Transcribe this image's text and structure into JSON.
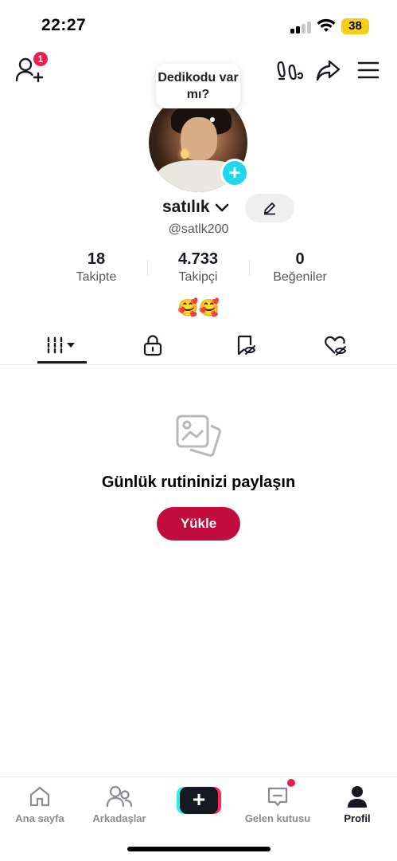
{
  "status_bar": {
    "time": "22:27",
    "battery": "38"
  },
  "top_bar": {
    "notification_count": "1",
    "icons": [
      "add-friend-icon",
      "footprints-icon",
      "share-icon",
      "menu-icon"
    ]
  },
  "profile": {
    "bubble_text": "Dedikodu var mı?",
    "name": "satılık",
    "handle": "@satlk200",
    "stats": [
      {
        "value": "18",
        "label": "Takipte"
      },
      {
        "value": "4.733",
        "label": "Takipçi"
      },
      {
        "value": "0",
        "label": "Beğeniler"
      }
    ],
    "bio": "🥰🥰"
  },
  "tabs": [
    "videos-grid-icon",
    "lock-icon",
    "bookmark-hidden-icon",
    "heart-hidden-icon"
  ],
  "empty_state": {
    "title": "Günlük rutininizi paylaşın",
    "button": "Yükle"
  },
  "bottom_nav": [
    {
      "label": "Ana sayfa",
      "icon": "home-icon",
      "active": false
    },
    {
      "label": "Arkadaşlar",
      "icon": "friends-icon",
      "active": false
    },
    {
      "label": "",
      "icon": "create-icon",
      "active": false
    },
    {
      "label": "Gelen kutusu",
      "icon": "inbox-icon",
      "active": false
    },
    {
      "label": "Profil",
      "icon": "profile-icon",
      "active": true
    }
  ],
  "colors": {
    "accent": "#c10d3e",
    "badge": "#e81e4d",
    "plus": "#20d5ec",
    "battery": "#f7ce15"
  }
}
